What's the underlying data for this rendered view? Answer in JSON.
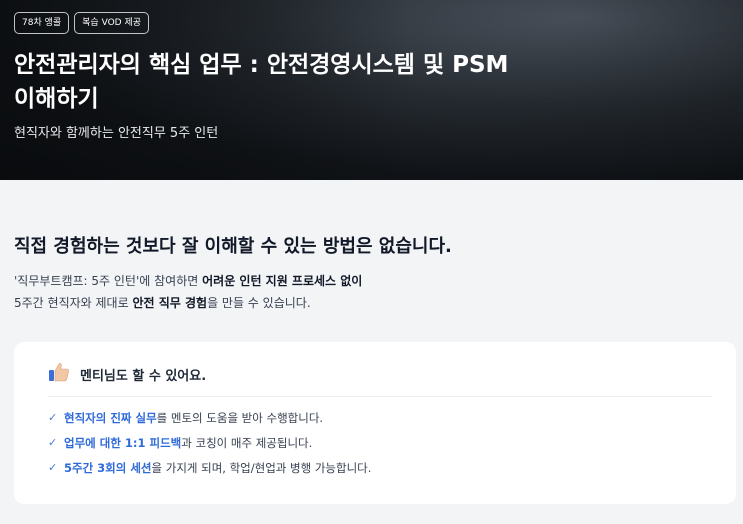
{
  "hero": {
    "badges": [
      "78차 앵콜",
      "복습 VOD 제공"
    ],
    "title": "안전관리자의 핵심 업무 : 안전경영시스템 및 PSM 이해하기",
    "subtitle": "현직자와 함께하는 안전직무 5주 인턴"
  },
  "intro": {
    "headline": "직접 경험하는 것보다 잘 이해할 수 있는 방법은 없습니다.",
    "line1_prefix": "'직무부트캠프: 5주 인턴'에 참여하면 ",
    "line1_bold": "어려운 인턴 지원 프로세스 없이",
    "line2_prefix": "5주간 현직자와 제대로 ",
    "line2_bold": "안전 직무 경험",
    "line2_suffix": "을 만들 수 있습니다."
  },
  "card": {
    "icon": "thumbs-up-icon",
    "title": "멘티님도 할 수 있어요.",
    "items": [
      {
        "highlight": "현직자의 진짜 실무",
        "text": "를 멘토의 도움을 받아 수행합니다."
      },
      {
        "highlight": "업무에 대한 1:1 피드백",
        "text": "과 코칭이 매주 제공됩니다."
      },
      {
        "highlight": "5주간 3회의 세션",
        "text": "을 가지게 되며, 학업/현업과 병행 가능합니다."
      }
    ]
  },
  "colors": {
    "accent": "#2f6bd8",
    "check": "#4b7bd8",
    "background": "#f3f4f6"
  }
}
